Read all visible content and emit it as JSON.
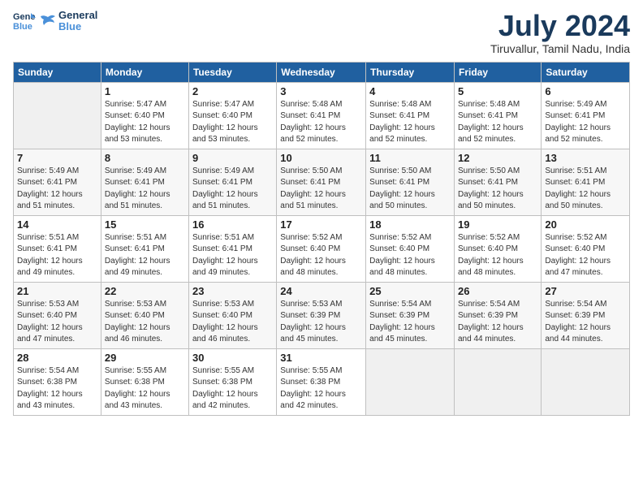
{
  "logo": {
    "line1": "General",
    "line2": "Blue"
  },
  "header": {
    "title": "July 2024",
    "subtitle": "Tiruvallur, Tamil Nadu, India"
  },
  "columns": [
    "Sunday",
    "Monday",
    "Tuesday",
    "Wednesday",
    "Thursday",
    "Friday",
    "Saturday"
  ],
  "weeks": [
    [
      {
        "day": "",
        "info": ""
      },
      {
        "day": "1",
        "info": "Sunrise: 5:47 AM\nSunset: 6:40 PM\nDaylight: 12 hours\nand 53 minutes."
      },
      {
        "day": "2",
        "info": "Sunrise: 5:47 AM\nSunset: 6:40 PM\nDaylight: 12 hours\nand 53 minutes."
      },
      {
        "day": "3",
        "info": "Sunrise: 5:48 AM\nSunset: 6:41 PM\nDaylight: 12 hours\nand 52 minutes."
      },
      {
        "day": "4",
        "info": "Sunrise: 5:48 AM\nSunset: 6:41 PM\nDaylight: 12 hours\nand 52 minutes."
      },
      {
        "day": "5",
        "info": "Sunrise: 5:48 AM\nSunset: 6:41 PM\nDaylight: 12 hours\nand 52 minutes."
      },
      {
        "day": "6",
        "info": "Sunrise: 5:49 AM\nSunset: 6:41 PM\nDaylight: 12 hours\nand 52 minutes."
      }
    ],
    [
      {
        "day": "7",
        "info": "Sunrise: 5:49 AM\nSunset: 6:41 PM\nDaylight: 12 hours\nand 51 minutes."
      },
      {
        "day": "8",
        "info": "Sunrise: 5:49 AM\nSunset: 6:41 PM\nDaylight: 12 hours\nand 51 minutes."
      },
      {
        "day": "9",
        "info": "Sunrise: 5:49 AM\nSunset: 6:41 PM\nDaylight: 12 hours\nand 51 minutes."
      },
      {
        "day": "10",
        "info": "Sunrise: 5:50 AM\nSunset: 6:41 PM\nDaylight: 12 hours\nand 51 minutes."
      },
      {
        "day": "11",
        "info": "Sunrise: 5:50 AM\nSunset: 6:41 PM\nDaylight: 12 hours\nand 50 minutes."
      },
      {
        "day": "12",
        "info": "Sunrise: 5:50 AM\nSunset: 6:41 PM\nDaylight: 12 hours\nand 50 minutes."
      },
      {
        "day": "13",
        "info": "Sunrise: 5:51 AM\nSunset: 6:41 PM\nDaylight: 12 hours\nand 50 minutes."
      }
    ],
    [
      {
        "day": "14",
        "info": "Sunrise: 5:51 AM\nSunset: 6:41 PM\nDaylight: 12 hours\nand 49 minutes."
      },
      {
        "day": "15",
        "info": "Sunrise: 5:51 AM\nSunset: 6:41 PM\nDaylight: 12 hours\nand 49 minutes."
      },
      {
        "day": "16",
        "info": "Sunrise: 5:51 AM\nSunset: 6:41 PM\nDaylight: 12 hours\nand 49 minutes."
      },
      {
        "day": "17",
        "info": "Sunrise: 5:52 AM\nSunset: 6:40 PM\nDaylight: 12 hours\nand 48 minutes."
      },
      {
        "day": "18",
        "info": "Sunrise: 5:52 AM\nSunset: 6:40 PM\nDaylight: 12 hours\nand 48 minutes."
      },
      {
        "day": "19",
        "info": "Sunrise: 5:52 AM\nSunset: 6:40 PM\nDaylight: 12 hours\nand 48 minutes."
      },
      {
        "day": "20",
        "info": "Sunrise: 5:52 AM\nSunset: 6:40 PM\nDaylight: 12 hours\nand 47 minutes."
      }
    ],
    [
      {
        "day": "21",
        "info": "Sunrise: 5:53 AM\nSunset: 6:40 PM\nDaylight: 12 hours\nand 47 minutes."
      },
      {
        "day": "22",
        "info": "Sunrise: 5:53 AM\nSunset: 6:40 PM\nDaylight: 12 hours\nand 46 minutes."
      },
      {
        "day": "23",
        "info": "Sunrise: 5:53 AM\nSunset: 6:40 PM\nDaylight: 12 hours\nand 46 minutes."
      },
      {
        "day": "24",
        "info": "Sunrise: 5:53 AM\nSunset: 6:39 PM\nDaylight: 12 hours\nand 45 minutes."
      },
      {
        "day": "25",
        "info": "Sunrise: 5:54 AM\nSunset: 6:39 PM\nDaylight: 12 hours\nand 45 minutes."
      },
      {
        "day": "26",
        "info": "Sunrise: 5:54 AM\nSunset: 6:39 PM\nDaylight: 12 hours\nand 44 minutes."
      },
      {
        "day": "27",
        "info": "Sunrise: 5:54 AM\nSunset: 6:39 PM\nDaylight: 12 hours\nand 44 minutes."
      }
    ],
    [
      {
        "day": "28",
        "info": "Sunrise: 5:54 AM\nSunset: 6:38 PM\nDaylight: 12 hours\nand 43 minutes."
      },
      {
        "day": "29",
        "info": "Sunrise: 5:55 AM\nSunset: 6:38 PM\nDaylight: 12 hours\nand 43 minutes."
      },
      {
        "day": "30",
        "info": "Sunrise: 5:55 AM\nSunset: 6:38 PM\nDaylight: 12 hours\nand 42 minutes."
      },
      {
        "day": "31",
        "info": "Sunrise: 5:55 AM\nSunset: 6:38 PM\nDaylight: 12 hours\nand 42 minutes."
      },
      {
        "day": "",
        "info": ""
      },
      {
        "day": "",
        "info": ""
      },
      {
        "day": "",
        "info": ""
      }
    ]
  ]
}
